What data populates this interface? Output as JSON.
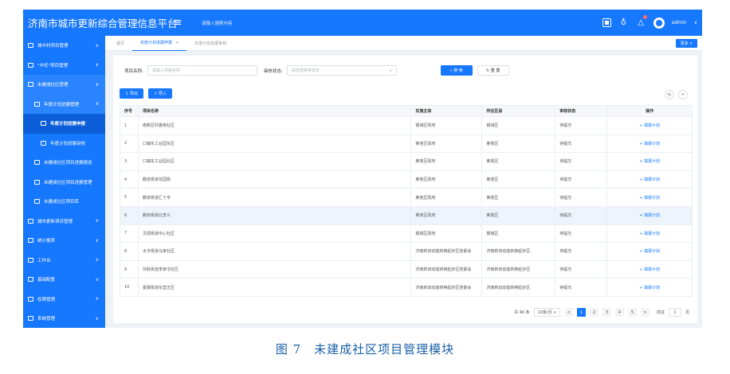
{
  "header": {
    "title": "济南市城市更新综合管理信息平台",
    "menu_icon": "hamburger-icon",
    "search_placeholder": "请输入搜索内容",
    "user": "admin",
    "user_caret": "∨"
  },
  "sidebar": {
    "items": [
      {
        "label": "城中村项目管理",
        "caret": "∨"
      },
      {
        "label": "\"中优\"项目管理",
        "caret": "∨"
      },
      {
        "label": "未建成社区管理",
        "caret": "∧"
      },
      {
        "label": "年度计划进展管理",
        "caret": "∧"
      },
      {
        "label": "年度计划进展申报",
        "caret": ""
      },
      {
        "label": "年度计划进展审核",
        "caret": ""
      },
      {
        "label": "未建成社区项目进展报送",
        "caret": ""
      },
      {
        "label": "未建成社区项目进展管理",
        "caret": ""
      },
      {
        "label": "未建成社区项目库",
        "caret": ""
      },
      {
        "label": "城市更新项目管理",
        "caret": "∨"
      },
      {
        "label": "统计报表",
        "caret": "∨"
      },
      {
        "label": "工作台",
        "caret": "∨"
      },
      {
        "label": "基础配置",
        "caret": "∨"
      },
      {
        "label": "权限管理",
        "caret": "∨"
      },
      {
        "label": "系统管理",
        "caret": "∨"
      }
    ]
  },
  "tabs": {
    "items": [
      "首页",
      "年度计划进展申报",
      "年度计划进展审核"
    ],
    "close": "×",
    "more": "更多 ∨"
  },
  "filter": {
    "project_label": "项目名称:",
    "project_placeholder": "请输入项目名称",
    "status_label": "审核状态:",
    "status_placeholder": "请选择审核状态",
    "search_btn": "⌕ 搜 索",
    "reset_btn": "↻ 重 置"
  },
  "actions": {
    "export": "⇩ 导出",
    "import": "⇧ 导入"
  },
  "table": {
    "columns": [
      "序号",
      "项目名称",
      "实施主体",
      "所在区县",
      "审核状态",
      "操作"
    ],
    "rows": [
      [
        "1",
        "南新区村委南社区",
        "钢城区政府",
        "钢城区",
        "待提交",
        "+ 填报计划"
      ],
      [
        "2",
        "口镇东工业园东区",
        "莱芜区政府",
        "莱芜区",
        "待提交",
        "+ 填报计划"
      ],
      [
        "3",
        "口镇东工业园北区",
        "莱芜区政府",
        "莱芜区",
        "待提交",
        "+ 填报计划"
      ],
      [
        "4",
        "鹏泉街道花园街",
        "莱芜区政府",
        "莱芜区",
        "待提交",
        "+ 填报计划"
      ],
      [
        "5",
        "鹏泉街道汇十字",
        "莱芜区政府",
        "莱芜区",
        "待提交",
        "+ 填报计划"
      ],
      [
        "6",
        "鹏泉街道北李义",
        "莱芜区政府",
        "莱芜区",
        "待提交",
        "+ 填报计划"
      ],
      [
        "7",
        "汶源街道中心社区",
        "钢城区政府",
        "钢城区",
        "待提交",
        "+ 填报计划"
      ],
      [
        "8",
        "太平街道马家社区",
        "济南新旧动能转换起步区管委会",
        "济南新旧动能转换起步区",
        "待提交",
        "+ 填报计划"
      ],
      [
        "9",
        "孙耿街道李家屯社区",
        "济南新旧动能转换起步区管委会",
        "济南新旧动能转换起步区",
        "待提交",
        "+ 填报计划"
      ],
      [
        "10",
        "崔寨街道东营五区",
        "济南新旧动能转换起步区管委会",
        "济南新旧动能转换起步区",
        "待提交",
        "+ 填报计划"
      ]
    ]
  },
  "pager": {
    "total": "共 46 条",
    "page_size": "10条/页 ∨",
    "prev": "<",
    "pages": [
      "1",
      "2",
      "3",
      "4",
      "5"
    ],
    "next": ">",
    "goto_label": "前往",
    "goto_value": "1",
    "goto_suffix": "页"
  },
  "caption": "图 7　未建成社区项目管理模块"
}
